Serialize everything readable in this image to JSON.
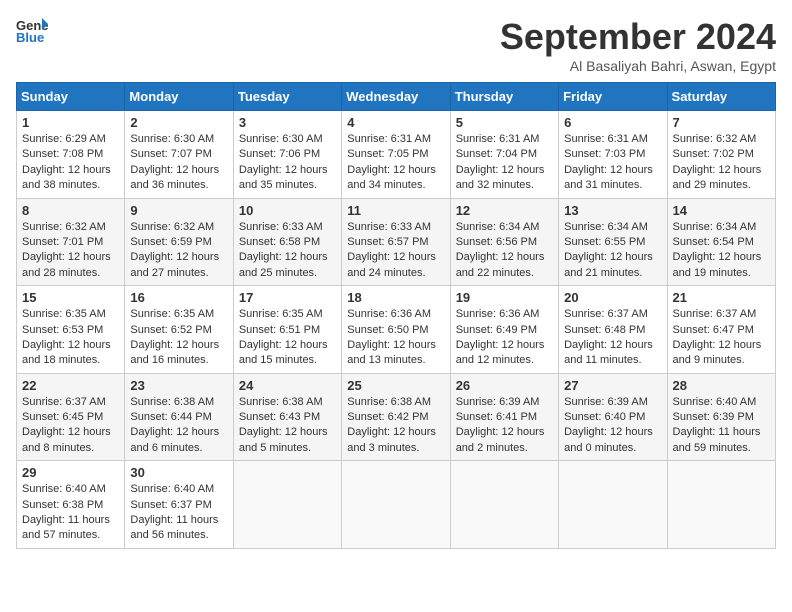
{
  "header": {
    "logo_line1": "General",
    "logo_line2": "Blue",
    "month_title": "September 2024",
    "location": "Al Basaliyah Bahri, Aswan, Egypt"
  },
  "weekdays": [
    "Sunday",
    "Monday",
    "Tuesday",
    "Wednesday",
    "Thursday",
    "Friday",
    "Saturday"
  ],
  "weeks": [
    [
      {
        "day": "1",
        "sunrise": "6:29 AM",
        "sunset": "7:08 PM",
        "daylight": "12 hours and 38 minutes."
      },
      {
        "day": "2",
        "sunrise": "6:30 AM",
        "sunset": "7:07 PM",
        "daylight": "12 hours and 36 minutes."
      },
      {
        "day": "3",
        "sunrise": "6:30 AM",
        "sunset": "7:06 PM",
        "daylight": "12 hours and 35 minutes."
      },
      {
        "day": "4",
        "sunrise": "6:31 AM",
        "sunset": "7:05 PM",
        "daylight": "12 hours and 34 minutes."
      },
      {
        "day": "5",
        "sunrise": "6:31 AM",
        "sunset": "7:04 PM",
        "daylight": "12 hours and 32 minutes."
      },
      {
        "day": "6",
        "sunrise": "6:31 AM",
        "sunset": "7:03 PM",
        "daylight": "12 hours and 31 minutes."
      },
      {
        "day": "7",
        "sunrise": "6:32 AM",
        "sunset": "7:02 PM",
        "daylight": "12 hours and 29 minutes."
      }
    ],
    [
      {
        "day": "8",
        "sunrise": "6:32 AM",
        "sunset": "7:01 PM",
        "daylight": "12 hours and 28 minutes."
      },
      {
        "day": "9",
        "sunrise": "6:32 AM",
        "sunset": "6:59 PM",
        "daylight": "12 hours and 27 minutes."
      },
      {
        "day": "10",
        "sunrise": "6:33 AM",
        "sunset": "6:58 PM",
        "daylight": "12 hours and 25 minutes."
      },
      {
        "day": "11",
        "sunrise": "6:33 AM",
        "sunset": "6:57 PM",
        "daylight": "12 hours and 24 minutes."
      },
      {
        "day": "12",
        "sunrise": "6:34 AM",
        "sunset": "6:56 PM",
        "daylight": "12 hours and 22 minutes."
      },
      {
        "day": "13",
        "sunrise": "6:34 AM",
        "sunset": "6:55 PM",
        "daylight": "12 hours and 21 minutes."
      },
      {
        "day": "14",
        "sunrise": "6:34 AM",
        "sunset": "6:54 PM",
        "daylight": "12 hours and 19 minutes."
      }
    ],
    [
      {
        "day": "15",
        "sunrise": "6:35 AM",
        "sunset": "6:53 PM",
        "daylight": "12 hours and 18 minutes."
      },
      {
        "day": "16",
        "sunrise": "6:35 AM",
        "sunset": "6:52 PM",
        "daylight": "12 hours and 16 minutes."
      },
      {
        "day": "17",
        "sunrise": "6:35 AM",
        "sunset": "6:51 PM",
        "daylight": "12 hours and 15 minutes."
      },
      {
        "day": "18",
        "sunrise": "6:36 AM",
        "sunset": "6:50 PM",
        "daylight": "12 hours and 13 minutes."
      },
      {
        "day": "19",
        "sunrise": "6:36 AM",
        "sunset": "6:49 PM",
        "daylight": "12 hours and 12 minutes."
      },
      {
        "day": "20",
        "sunrise": "6:37 AM",
        "sunset": "6:48 PM",
        "daylight": "12 hours and 11 minutes."
      },
      {
        "day": "21",
        "sunrise": "6:37 AM",
        "sunset": "6:47 PM",
        "daylight": "12 hours and 9 minutes."
      }
    ],
    [
      {
        "day": "22",
        "sunrise": "6:37 AM",
        "sunset": "6:45 PM",
        "daylight": "12 hours and 8 minutes."
      },
      {
        "day": "23",
        "sunrise": "6:38 AM",
        "sunset": "6:44 PM",
        "daylight": "12 hours and 6 minutes."
      },
      {
        "day": "24",
        "sunrise": "6:38 AM",
        "sunset": "6:43 PM",
        "daylight": "12 hours and 5 minutes."
      },
      {
        "day": "25",
        "sunrise": "6:38 AM",
        "sunset": "6:42 PM",
        "daylight": "12 hours and 3 minutes."
      },
      {
        "day": "26",
        "sunrise": "6:39 AM",
        "sunset": "6:41 PM",
        "daylight": "12 hours and 2 minutes."
      },
      {
        "day": "27",
        "sunrise": "6:39 AM",
        "sunset": "6:40 PM",
        "daylight": "12 hours and 0 minutes."
      },
      {
        "day": "28",
        "sunrise": "6:40 AM",
        "sunset": "6:39 PM",
        "daylight": "11 hours and 59 minutes."
      }
    ],
    [
      {
        "day": "29",
        "sunrise": "6:40 AM",
        "sunset": "6:38 PM",
        "daylight": "11 hours and 57 minutes."
      },
      {
        "day": "30",
        "sunrise": "6:40 AM",
        "sunset": "6:37 PM",
        "daylight": "11 hours and 56 minutes."
      },
      null,
      null,
      null,
      null,
      null
    ]
  ]
}
